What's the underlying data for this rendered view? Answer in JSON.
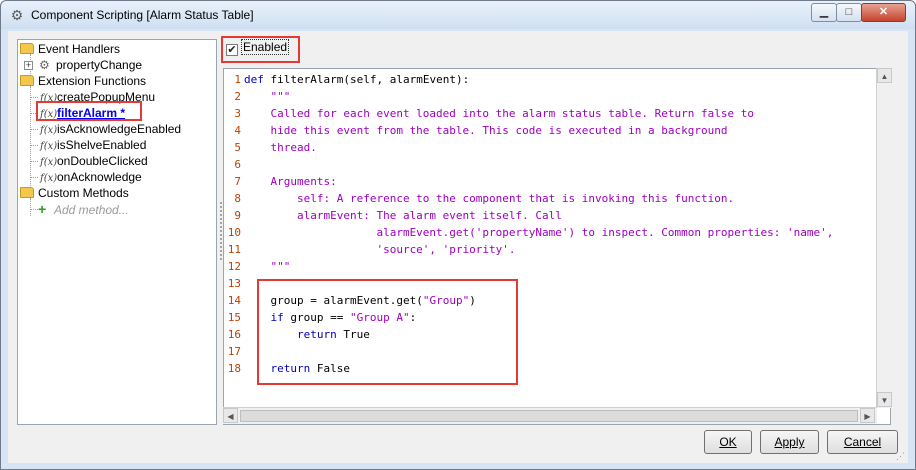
{
  "window": {
    "title": "Component Scripting [Alarm Status Table]"
  },
  "tree": {
    "event_handlers": {
      "label": "Event Handlers",
      "children": [
        {
          "label": "propertyChange"
        }
      ]
    },
    "extension_functions": {
      "label": "Extension Functions",
      "children": [
        {
          "label": "createPopupMenu"
        },
        {
          "label": "filterAlarm *"
        },
        {
          "label": "isAcknowledgeEnabled"
        },
        {
          "label": "isShelveEnabled"
        },
        {
          "label": "onDoubleClicked"
        },
        {
          "label": "onAcknowledge"
        }
      ]
    },
    "custom_methods": {
      "label": "Custom Methods",
      "add_label": "Add method..."
    }
  },
  "enabled": {
    "label": "Enabled",
    "checked": true
  },
  "editor": {
    "lines": [
      {
        "n": "1",
        "text": "def filterAlarm(self, alarmEvent):"
      },
      {
        "n": "2",
        "text": "    \"\"\""
      },
      {
        "n": "3",
        "text": "    Called for each event loaded into the alarm status table. Return false to"
      },
      {
        "n": "4",
        "text": "    hide this event from the table. This code is executed in a background"
      },
      {
        "n": "5",
        "text": "    thread."
      },
      {
        "n": "6",
        "text": ""
      },
      {
        "n": "7",
        "text": "    Arguments:"
      },
      {
        "n": "8",
        "text": "        self: A reference to the component that is invoking this function."
      },
      {
        "n": "9",
        "text": "        alarmEvent: The alarm event itself. Call"
      },
      {
        "n": "10",
        "text": "                    alarmEvent.get('propertyName') to inspect. Common properties: 'name',"
      },
      {
        "n": "11",
        "text": "                    'source', 'priority'."
      },
      {
        "n": "12",
        "text": "    \"\"\""
      },
      {
        "n": "13",
        "text": ""
      },
      {
        "n": "14",
        "text": "    group = alarmEvent.get(\"Group\")"
      },
      {
        "n": "15",
        "text": "    if group == \"Group A\":"
      },
      {
        "n": "16",
        "text": "        return True"
      },
      {
        "n": "17",
        "text": ""
      },
      {
        "n": "18",
        "text": "    return False"
      }
    ]
  },
  "buttons": {
    "ok": "OK",
    "apply": "Apply",
    "cancel": "Cancel"
  },
  "colors": {
    "highlight": "#e53935",
    "keyword": "#0000c0",
    "string": "#9d00c0",
    "line_number": "#c04000"
  }
}
